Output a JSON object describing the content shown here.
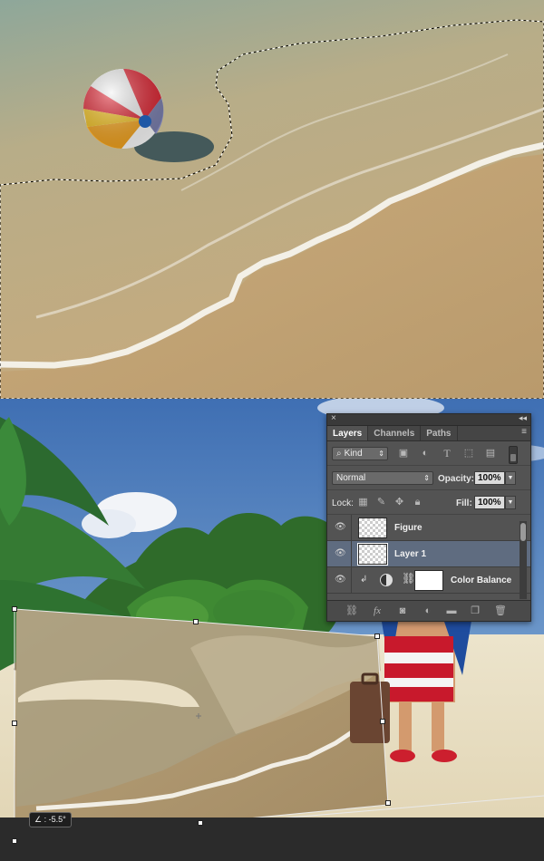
{
  "layers_panel": {
    "close_glyph": "×",
    "collapse_glyph": "◂◂",
    "tabs": [
      {
        "label": "Layers",
        "active": true
      },
      {
        "label": "Channels",
        "active": false
      },
      {
        "label": "Paths",
        "active": false
      }
    ],
    "menu_glyph": "≡",
    "filter": {
      "kind_label": "Kind",
      "icons": [
        "image-filter-icon",
        "adjustment-filter-icon",
        "type-filter-icon",
        "shape-filter-icon",
        "smart-object-filter-icon"
      ]
    },
    "blend_mode": "Normal",
    "opacity_label": "Opacity:",
    "opacity_value": "100%",
    "lock_label": "Lock:",
    "fill_label": "Fill:",
    "fill_value": "100%",
    "layers": [
      {
        "name": "Figure",
        "visible": true,
        "selected": false
      },
      {
        "name": "Layer 1",
        "visible": true,
        "selected": true
      },
      {
        "name": "Color Balance",
        "visible": true,
        "selected": false,
        "adjustment": true
      }
    ],
    "footer_icons": [
      "link-layers-icon",
      "fx-icon",
      "add-mask-icon",
      "new-adjustment-icon",
      "new-group-icon",
      "new-layer-icon",
      "delete-layer-icon"
    ]
  },
  "transform": {
    "angle_readout": "∠ : -5.5°"
  },
  "colors": {
    "panel_bg": "#535353",
    "selected_layer": "#5f6c80",
    "sky_top": "#3f6fb3"
  }
}
